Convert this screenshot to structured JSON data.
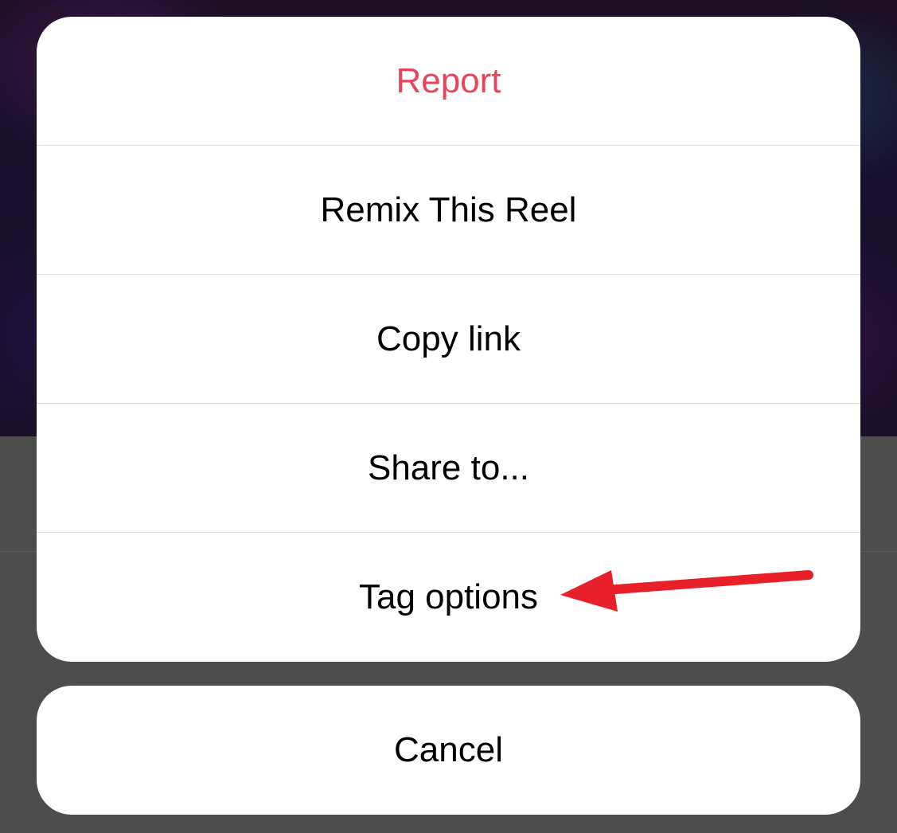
{
  "action_sheet": {
    "options": [
      {
        "label": "Report",
        "style": "destructive",
        "color": "#e8455a"
      },
      {
        "label": "Remix This Reel",
        "style": "default"
      },
      {
        "label": "Copy link",
        "style": "default"
      },
      {
        "label": "Share to...",
        "style": "default"
      },
      {
        "label": "Tag options",
        "style": "default"
      }
    ],
    "cancel_label": "Cancel"
  },
  "annotation": {
    "type": "arrow",
    "color": "#e8202a",
    "points_to": "Tag options"
  }
}
